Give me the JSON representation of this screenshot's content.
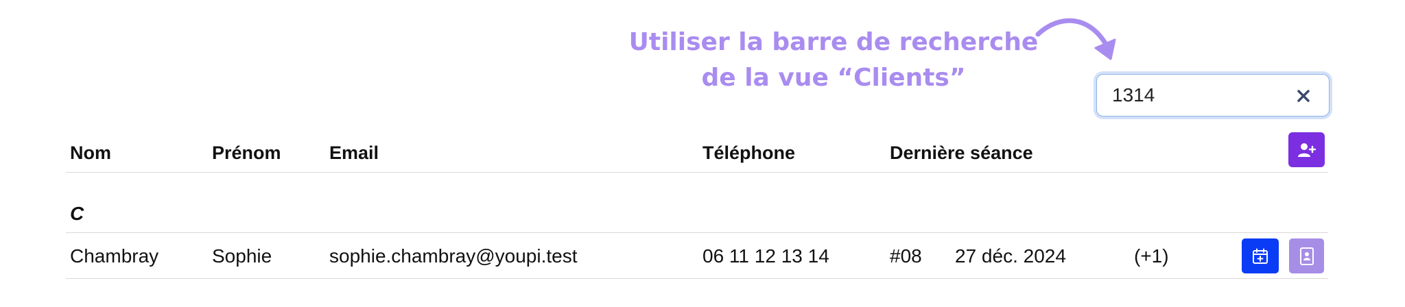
{
  "annotation": {
    "line1": "Utiliser la barre de recherche",
    "line2": "de la vue “Clients”"
  },
  "search": {
    "value": "1314",
    "clear_icon": "close-icon"
  },
  "table": {
    "headers": [
      "Nom",
      "Prénom",
      "Email",
      "Téléphone",
      "Dernière séance"
    ],
    "groups": [
      {
        "letter": "C",
        "rows": [
          {
            "nom": "Chambray",
            "prenom": "Sophie",
            "email": "sophie.chambray@youpi.test",
            "telephone": "06 11 12 13 14",
            "seance_num": "#08",
            "seance_date": "27 déc. 2024",
            "seance_extra": "(+1)"
          }
        ]
      }
    ]
  },
  "icons": {
    "add_client": "add-user-icon",
    "new_session": "calendar-plus-icon",
    "contact_card": "contact-card-icon"
  },
  "colors": {
    "annotation": "#a98cef",
    "add_button": "#7c2fe0",
    "calendar_button": "#0b3cf5",
    "contact_button": "#a68de6",
    "search_focus": "#8fb2ea"
  }
}
